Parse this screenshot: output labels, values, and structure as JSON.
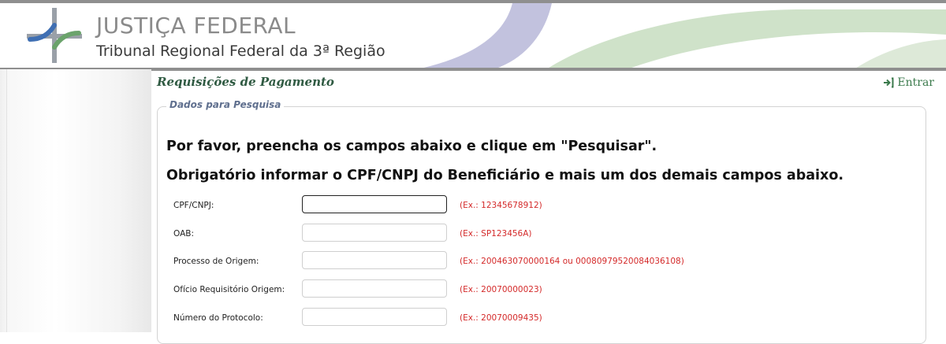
{
  "header": {
    "brand_title": "JUSTIÇA FEDERAL",
    "brand_subtitle": "Tribunal Regional Federal da 3ª Região"
  },
  "page": {
    "title": "Requisições de Pagamento",
    "login_label": "Entrar"
  },
  "search": {
    "legend": "Dados para Pesquisa",
    "instruction_1": "Por favor, preencha os campos abaixo e clique em \"Pesquisar\".",
    "instruction_2": "Obrigatório informar o CPF/CNPJ do Beneficiário e mais um dos demais campos abaixo.",
    "fields": [
      {
        "label": "CPF/CNPJ:",
        "value": "",
        "hint": "(Ex.: 12345678912)"
      },
      {
        "label": "OAB:",
        "value": "",
        "hint": "(Ex.: SP123456A)"
      },
      {
        "label": "Processo de Origem:",
        "value": "",
        "hint": "(Ex.: 200463070000164 ou 00080979520084036108)"
      },
      {
        "label": "Ofício Requisitório Origem:",
        "value": "",
        "hint": "(Ex.: 20070000023)"
      },
      {
        "label": "Número do Protocolo:",
        "value": "",
        "hint": "(Ex.: 20070009435)"
      }
    ]
  },
  "colors": {
    "title_green": "#2f5a42",
    "hint_red": "#d42a2a",
    "legend_blue": "#5f6f8e",
    "swoosh_purple": "#bcbcda",
    "swoosh_green": "#c9dcc2"
  },
  "icons": {
    "logo": "jf-logo-icon",
    "login": "login-arrow-icon"
  }
}
